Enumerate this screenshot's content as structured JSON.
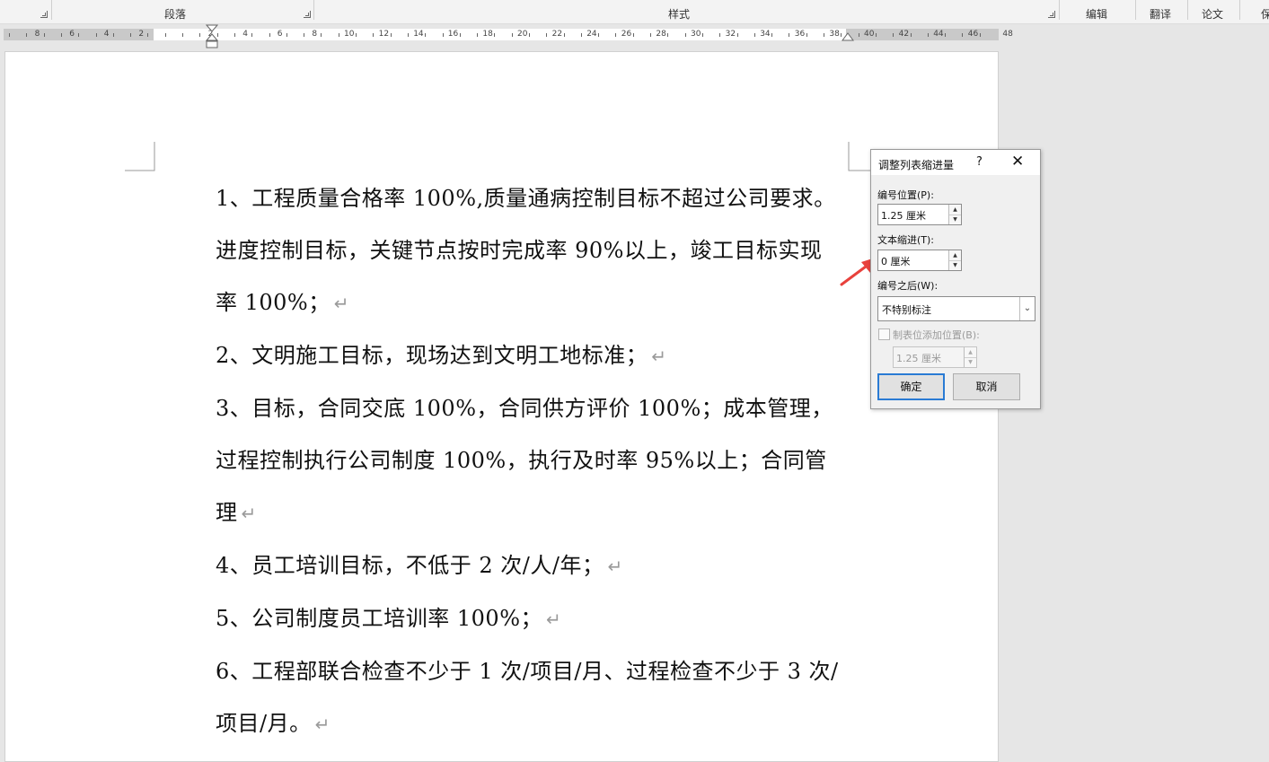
{
  "ribbon": {
    "groups": [
      "段落",
      "样式"
    ],
    "tabs": [
      "编辑",
      "翻译",
      "论文",
      "保"
    ]
  },
  "ruler": {
    "left_numbers": [
      "8",
      "6",
      "4",
      "2"
    ],
    "numbers": [
      "2",
      "4",
      "6",
      "8",
      "10",
      "12",
      "14",
      "16",
      "18",
      "20",
      "22",
      "24",
      "26",
      "28",
      "30",
      "32",
      "34",
      "36",
      "38",
      "40",
      "42",
      "44",
      "46",
      "48"
    ]
  },
  "document": {
    "paragraphs": [
      "1、工程质量合格率 100%,质量通病控制目标不超过公司要求。",
      "进度控制目标，关键节点按时完成率 90%以上，竣工目标实现",
      "率 100%；",
      "2、文明施工目标，现场达到文明工地标准；",
      "3、目标，合同交底 100%，合同供方评价 100%；成本管理，",
      "过程控制执行公司制度 100%，执行及时率 95%以上；合同管",
      "理",
      "4、员工培训目标，不低于 2 次/人/年；",
      "5、公司制度员工培训率 100%；",
      "6、工程部联合检查不少于 1 次/项目/月、过程检查不少于 3 次/",
      "项目/月。"
    ],
    "paragraph_mark": "↵",
    "line_has_mark": [
      false,
      false,
      true,
      true,
      false,
      false,
      true,
      true,
      true,
      false,
      true
    ]
  },
  "dialog": {
    "title": "调整列表缩进量",
    "help": "?",
    "close": "✕",
    "number_position_label": "编号位置(P):",
    "number_position_value": "1.25 厘米",
    "text_indent_label": "文本缩进(T):",
    "text_indent_value": "0 厘米",
    "follow_number_label": "编号之后(W):",
    "follow_number_value": "不特别标注",
    "tab_stop_label": "制表位添加位置(B):",
    "tab_stop_value": "1.25 厘米",
    "tab_stop_checked": false,
    "ok": "确定",
    "cancel": "取消"
  },
  "colors": {
    "accent": "#2a7bd4",
    "pointer_arrow": "#e8413c"
  }
}
